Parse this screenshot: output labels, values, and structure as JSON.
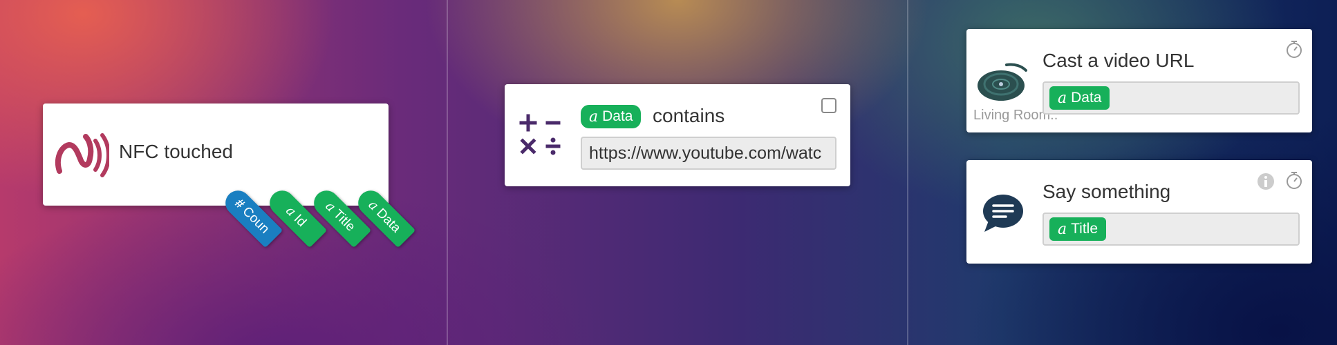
{
  "trigger": {
    "title": "NFC touched",
    "outputs": [
      {
        "symbol": "#",
        "label": "Coun",
        "color": "#1a7fc1"
      },
      {
        "symbol": "a",
        "label": "Id",
        "color": "#17b05a"
      },
      {
        "symbol": "a",
        "label": "Title",
        "color": "#17b05a"
      },
      {
        "symbol": "a",
        "label": "Data",
        "color": "#17b05a"
      }
    ]
  },
  "condition": {
    "input_symbol": "a",
    "input_label": "Data",
    "operator": "contains",
    "value": "https://www.youtube.com/watc",
    "checked": false
  },
  "actions": [
    {
      "title": "Cast a video URL",
      "device_label": "Living Room..",
      "param_symbol": "a",
      "param_label": "Data"
    },
    {
      "title": "Say something",
      "param_symbol": "a",
      "param_label": "Title"
    }
  ],
  "colors": {
    "nfc": "#b23a5e",
    "pill_green": "#17b05a",
    "number_blue": "#1a7fc1",
    "math_purple": "#4a2a6a",
    "chat_navy": "#1f3a55"
  }
}
